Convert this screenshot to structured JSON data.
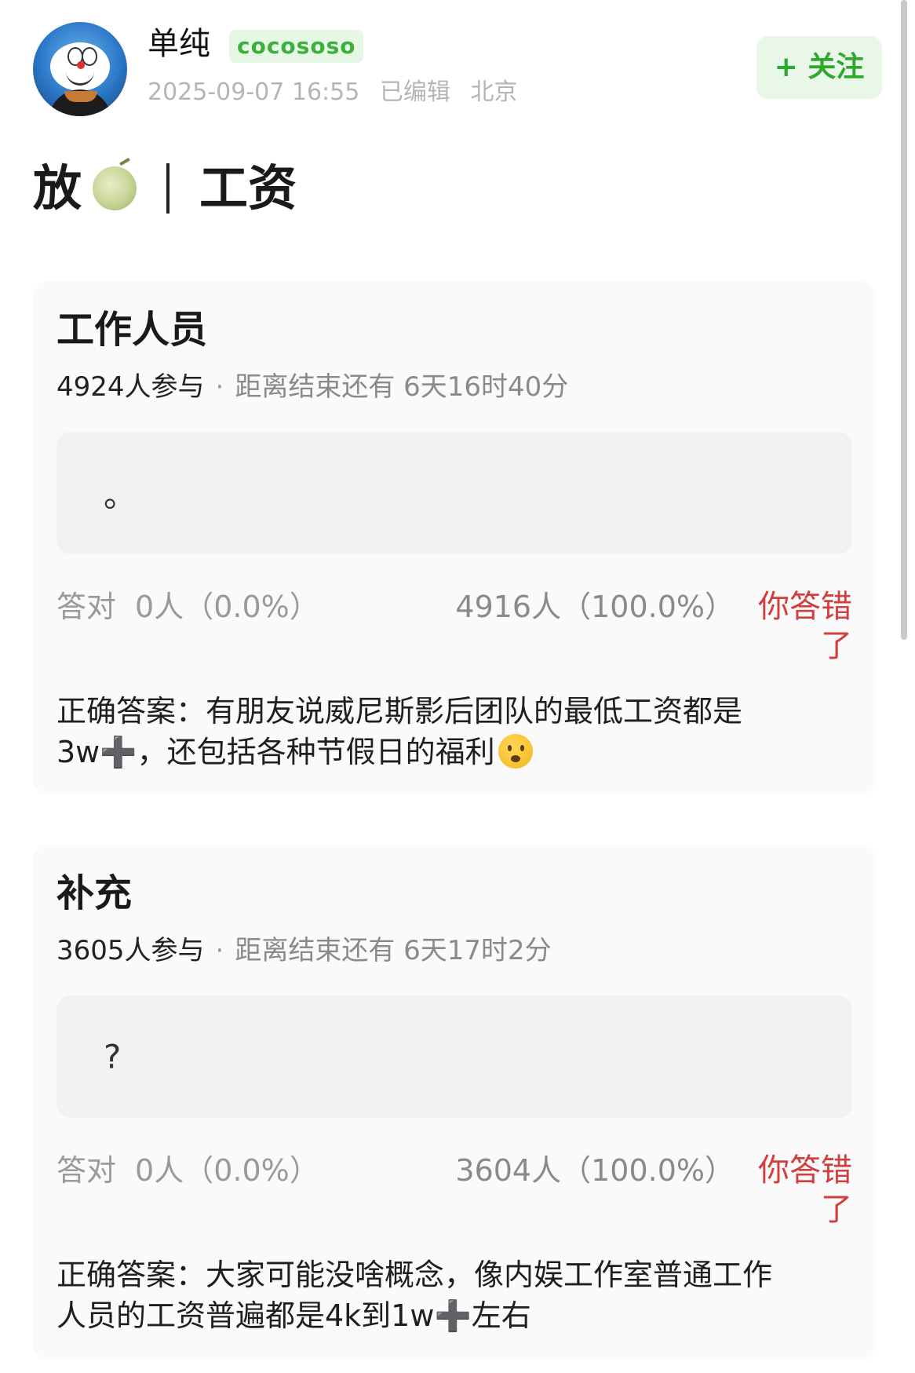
{
  "header": {
    "username": "单纯",
    "tag": "cocososo",
    "timestamp": "2025-09-07 16:55",
    "edited": "已编辑",
    "location": "北京",
    "follow_label": "+ 关注"
  },
  "post": {
    "title_left": "放",
    "title_right": "工资",
    "title_emoji": "melon"
  },
  "quizzes": [
    {
      "title": "工作人员",
      "participants": "4924人参与",
      "remaining": "距离结束还有 6天16时40分",
      "option_text": "。",
      "correct_label": "答对",
      "correct_stats": "0人（0.0%）",
      "wrong_stats": "4916人（100.0%）",
      "wrong_label": "你答错了",
      "answer": "正确答案：有朋友说威尼斯影后团队的最低工资都是3w➕，还包括各种节假日的福利"
    },
    {
      "title": "补充",
      "participants": "3605人参与",
      "remaining": "距离结束还有 6天17时2分",
      "option_text": "?",
      "correct_label": "答对",
      "correct_stats": "0人（0.0%）",
      "wrong_stats": "3604人（100.0%）",
      "wrong_label": "你答错了",
      "answer": "正确答案：大家可能没啥概念，像内娱工作室普通工作人员的工资普遍都是4k到1w➕左右"
    }
  ],
  "colors": {
    "accent_green": "#2fa82f",
    "wrong_red": "#d23d3d",
    "card_bg": "#fafafa"
  }
}
